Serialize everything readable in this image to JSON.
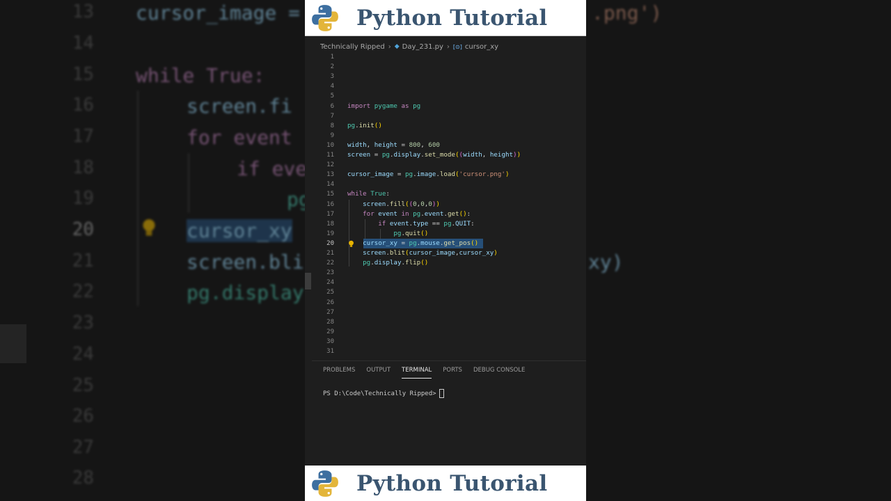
{
  "banner": {
    "title": "Python Tutorial"
  },
  "breadcrumb": [
    {
      "label": "Technically Ripped",
      "icon": ""
    },
    {
      "label": "Day_231.py",
      "icon": "python-file-icon"
    },
    {
      "label": "cursor_xy",
      "icon": "variable-symbol-icon"
    }
  ],
  "editor": {
    "active_line": 20,
    "line_numbers": [
      "1",
      "2",
      "3",
      "4",
      "5",
      "6",
      "7",
      "8",
      "9",
      "10",
      "11",
      "12",
      "13",
      "14",
      "15",
      "16",
      "17",
      "18",
      "19",
      "20",
      "21",
      "22",
      "23",
      "24",
      "25",
      "26",
      "27",
      "28",
      "29",
      "30",
      "31"
    ],
    "code_lines": [
      "",
      "",
      "",
      "",
      "",
      "import pygame as pg",
      "",
      "pg.init()",
      "",
      "width, height = 800, 600",
      "screen = pg.display.set_mode((width, height))",
      "",
      "cursor_image = pg.image.load('cursor.png')",
      "",
      "while True:",
      "    screen.fill((0,0,0))",
      "    for event in pg.event.get():",
      "        if event.type == pg.QUIT:",
      "            pg.quit()",
      "    cursor_xy = pg.mouse.get_pos()",
      "    screen.blit(cursor_image,cursor_xy)",
      "    pg.display.flip()",
      "",
      "",
      "",
      "",
      "",
      "",
      "",
      "",
      ""
    ],
    "selected_text": "cursor_xy = pg.mouse.get_pos()"
  },
  "terminal": {
    "tabs": [
      "PROBLEMS",
      "OUTPUT",
      "TERMINAL",
      "PORTS",
      "DEBUG CONSOLE"
    ],
    "active_tab": "TERMINAL",
    "prompt": "PS D:\\Code\\Technically Ripped>"
  },
  "background": {
    "line_numbers": [
      "13",
      "14",
      "15",
      "16",
      "17",
      "18",
      "19",
      "20",
      "21",
      "22",
      "23",
      "24",
      "25",
      "26",
      "27",
      "28"
    ],
    "code_fragments": [
      "cursor_image =",
      "while True:",
      "screen.fi",
      "for event",
      "if eve",
      "pg",
      "cursor_xy",
      "screen.bli",
      "pg.display"
    ],
    "right_fragments": [
      ".png')",
      "xy)"
    ]
  },
  "colors": {
    "keyword": "#c586c0",
    "builtin": "#4ec9b0",
    "function": "#dcdcaa",
    "variable": "#9cdcfe",
    "string": "#ce9178",
    "number": "#b5cea8",
    "selection": "#264f78",
    "banner_text": "#3a5570"
  }
}
